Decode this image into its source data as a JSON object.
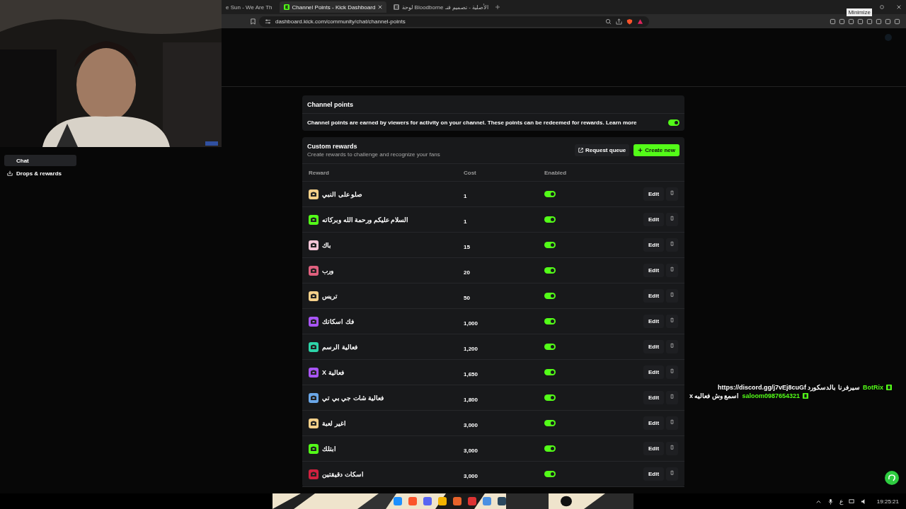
{
  "browser": {
    "tabs": [
      {
        "title": "e Sun - We Are Th",
        "selected": false,
        "kind": "plain"
      },
      {
        "title": "Channel Points - Kick Dashboard",
        "selected": true,
        "kind": "favicon"
      },
      {
        "title": "لوحة Bloodborne الأصلية - تصميم فنـ",
        "selected": false,
        "kind": "favicon"
      }
    ],
    "address": "dashboard.kick.com/community/chat/channel-points",
    "tooltip": "Minimize"
  },
  "sidebar": {
    "items": [
      {
        "label": "Chat",
        "selected": true,
        "kind": "plain"
      },
      {
        "label": "Drops & rewards",
        "selected": false,
        "kind": "icon"
      }
    ]
  },
  "channel_points": {
    "title": "Channel points",
    "description": "Channel points are earned by viewers for activity on your channel. These points can be redeemed for rewards.",
    "link": "Learn more",
    "enabled": true
  },
  "custom_rewards": {
    "title": "Custom rewards",
    "subtitle": "Create rewards to challenge and recognize your fans",
    "request_queue": "Request queue",
    "create_new": "Create new",
    "columns": [
      "Reward",
      "Cost",
      "Enabled"
    ],
    "rows": [
      {
        "name": "صلو على النبي",
        "cost": "1",
        "color": "#f5d08a",
        "enabled": true,
        "edit": "Edit"
      },
      {
        "name": "السلام عليكم ورحمة الله وبركاته",
        "cost": "1",
        "color": "#53fc18",
        "enabled": true,
        "edit": "Edit"
      },
      {
        "name": "باك",
        "cost": "15",
        "color": "#f6c6d8",
        "enabled": true,
        "edit": "Edit"
      },
      {
        "name": "ورب",
        "cost": "20",
        "color": "#e0607e",
        "enabled": true,
        "edit": "Edit"
      },
      {
        "name": "تريس",
        "cost": "50",
        "color": "#f5d08a",
        "enabled": true,
        "edit": "Edit"
      },
      {
        "name": "فك اسكاتك",
        "cost": "1,000",
        "color": "#a855f7",
        "enabled": true,
        "edit": "Edit"
      },
      {
        "name": "فعالية الرسم",
        "cost": "1,200",
        "color": "#2dd4a8",
        "enabled": true,
        "edit": "Edit"
      },
      {
        "name": "فعالية X",
        "cost": "1,650",
        "color": "#a855f7",
        "enabled": true,
        "edit": "Edit"
      },
      {
        "name": "فعالية شات جي بي تي",
        "cost": "1,800",
        "color": "#6aa7e8",
        "enabled": true,
        "edit": "Edit"
      },
      {
        "name": "اغير لعبة",
        "cost": "3,000",
        "color": "#f5d08a",
        "enabled": true,
        "edit": "Edit"
      },
      {
        "name": "ابتلك",
        "cost": "3,000",
        "color": "#53fc18",
        "enabled": true,
        "edit": "Edit"
      },
      {
        "name": "اسكات دقيقتين",
        "cost": "3,000",
        "color": "#d0213f",
        "enabled": true,
        "edit": "Edit"
      }
    ]
  },
  "chat_overlay": [
    {
      "username": "BotRix",
      "message": "سيرفرنا بالدسكورد https://discord.gg/j7vEj8cuGf"
    },
    {
      "username": "saloom0987654321",
      "message": "اسمع وش فعاليه x"
    }
  ],
  "taskbar": {
    "language": "ع",
    "time": "19:25:21"
  }
}
